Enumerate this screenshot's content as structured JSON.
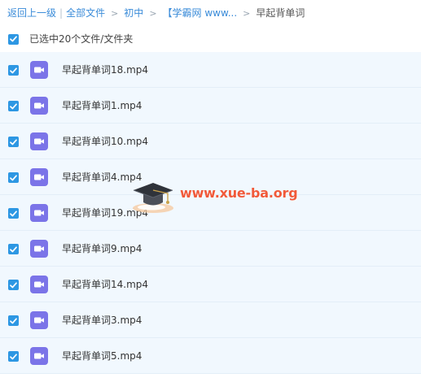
{
  "breadcrumb": {
    "back": "返回上一级",
    "separator": "|",
    "all_files": "全部文件",
    "level1": "初中",
    "level2": "【学霸网 www...",
    "current": "早起背单词",
    "arrow": ">"
  },
  "selection": {
    "label": "已选中20个文件/文件夹",
    "all_checked": true
  },
  "files": [
    {
      "name": "早起背单词18.mp4",
      "checked": true,
      "icon": "video-file-icon"
    },
    {
      "name": "早起背单词1.mp4",
      "checked": true,
      "icon": "video-file-icon"
    },
    {
      "name": "早起背单词10.mp4",
      "checked": true,
      "icon": "video-file-icon"
    },
    {
      "name": "早起背单词4.mp4",
      "checked": true,
      "icon": "video-file-icon"
    },
    {
      "name": "早起背单词19.mp4",
      "checked": true,
      "icon": "video-file-icon"
    },
    {
      "name": "早起背单词9.mp4",
      "checked": true,
      "icon": "video-file-icon"
    },
    {
      "name": "早起背单词14.mp4",
      "checked": true,
      "icon": "video-file-icon"
    },
    {
      "name": "早起背单词3.mp4",
      "checked": true,
      "icon": "video-file-icon"
    },
    {
      "name": "早起背单词5.mp4",
      "checked": true,
      "icon": "video-file-icon"
    }
  ],
  "watermark": {
    "text": "www.xue-ba.org"
  },
  "colors": {
    "link": "#3b8cd9",
    "checkbox": "#2d97e3",
    "row_background": "#f1f8fe",
    "video_icon": "#7b74e8",
    "watermark": "#f15a3a"
  }
}
